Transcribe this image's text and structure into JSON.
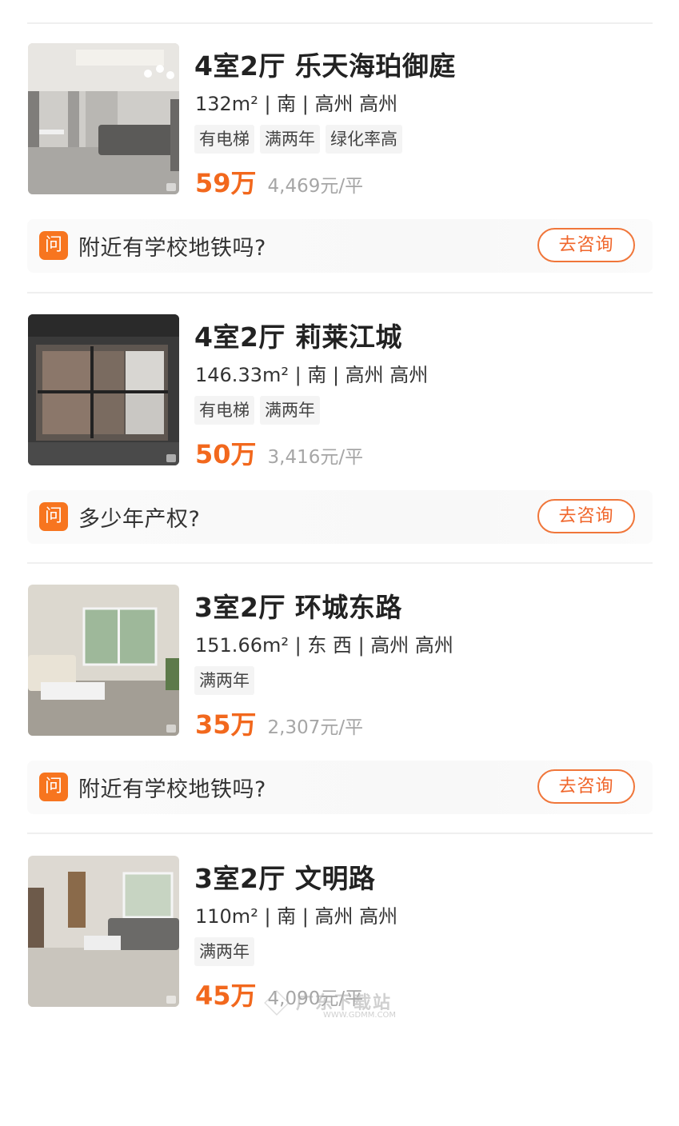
{
  "listings": [
    {
      "title": "4室2厅 乐天海珀御庭",
      "info": "132m² | 南 | 高州 高州",
      "tags": [
        "有电梯",
        "满两年",
        "绿化率高"
      ],
      "price_total": "59万",
      "price_unit": "4,469元/平",
      "question": "附近有学校地铁吗?",
      "consult_label": "去咨询"
    },
    {
      "title": "4室2厅 莉莱江城",
      "info": "146.33m² | 南 | 高州 高州",
      "tags": [
        "有电梯",
        "满两年"
      ],
      "price_total": "50万",
      "price_unit": "3,416元/平",
      "question": "多少年产权?",
      "consult_label": "去咨询"
    },
    {
      "title": "3室2厅 环城东路",
      "info": "151.66m² | 东 西 | 高州 高州",
      "tags": [
        "满两年"
      ],
      "price_total": "35万",
      "price_unit": "2,307元/平",
      "question": "附近有学校地铁吗?",
      "consult_label": "去咨询"
    },
    {
      "title": "3室2厅 文明路",
      "info": "110m² | 南 | 高州 高州",
      "tags": [
        "满两年"
      ],
      "price_total": "45万",
      "price_unit": "4,090元/平"
    }
  ],
  "qa_icon_char": "问",
  "watermark": {
    "title": "广东下载站",
    "url": "WWW.GDMM.COM"
  },
  "colors": {
    "price": "#f2681d",
    "accent": "#f7751f",
    "button_border": "#f0763a"
  }
}
